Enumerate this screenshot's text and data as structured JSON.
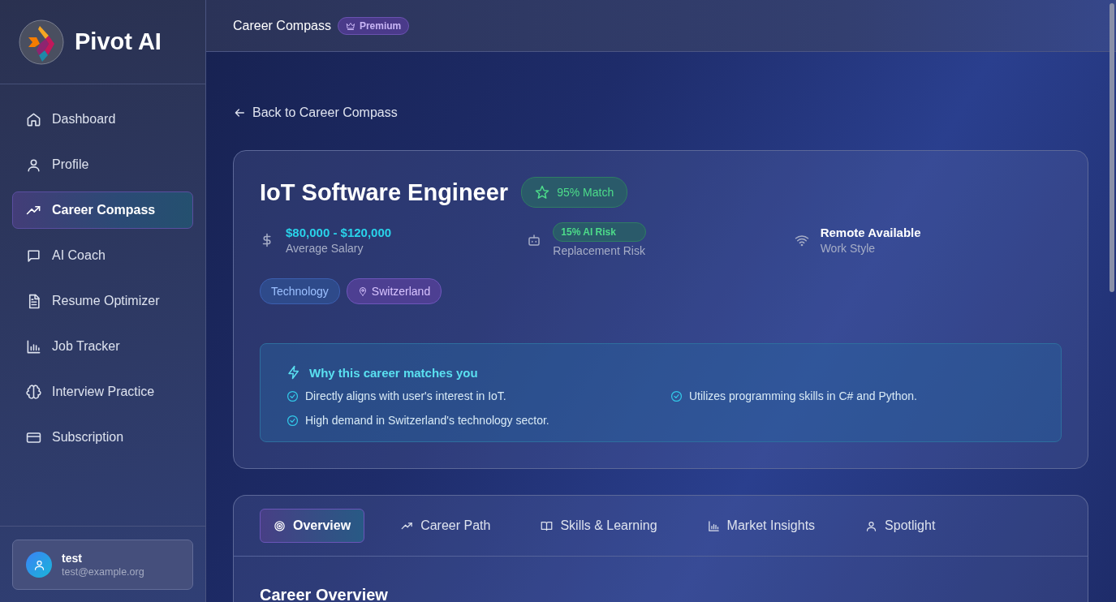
{
  "app": {
    "name": "Pivot AI"
  },
  "sidebar": {
    "items": [
      {
        "label": "Dashboard",
        "selected": false
      },
      {
        "label": "Profile",
        "selected": false
      },
      {
        "label": "Career Compass",
        "selected": true
      },
      {
        "label": "AI Coach",
        "selected": false
      },
      {
        "label": "Resume Optimizer",
        "selected": false
      },
      {
        "label": "Job Tracker",
        "selected": false
      },
      {
        "label": "Interview Practice",
        "selected": false
      },
      {
        "label": "Subscription",
        "selected": false
      }
    ]
  },
  "user": {
    "name": "test",
    "email": "test@example.org"
  },
  "header": {
    "title": "Career Compass",
    "badge": "Premium"
  },
  "back_link": "Back to Career Compass",
  "career": {
    "title": "IoT Software Engineer",
    "match": "95% Match",
    "stats": [
      {
        "kind": "salary",
        "value": "$80,000 - $120,000",
        "label": "Average Salary"
      },
      {
        "kind": "risk",
        "value": "15% AI Risk",
        "label": "Replacement Risk"
      },
      {
        "kind": "work",
        "value": "Remote Available",
        "label": "Work Style"
      }
    ],
    "tags": [
      {
        "kind": "category",
        "label": "Technology"
      },
      {
        "kind": "location",
        "label": "Switzerland"
      }
    ]
  },
  "reasons": {
    "title": "Why this career matches you",
    "items": [
      "Directly aligns with user's interest in IoT.",
      "Utilizes programming skills in C# and Python.",
      "High demand in Switzerland's technology sector."
    ]
  },
  "tabs": [
    {
      "label": "Overview",
      "selected": true
    },
    {
      "label": "Career Path",
      "selected": false
    },
    {
      "label": "Skills & Learning",
      "selected": false
    },
    {
      "label": "Market Insights",
      "selected": false
    },
    {
      "label": "Spotlight",
      "selected": false
    }
  ],
  "section_title": "Career Overview"
}
